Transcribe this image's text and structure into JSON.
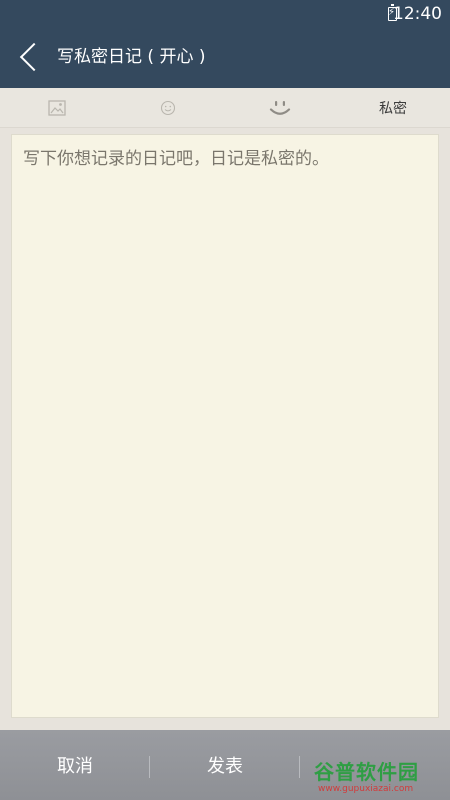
{
  "status_bar": {
    "time": "12:40"
  },
  "app_bar": {
    "title": "写私密日记 ( 开心 )"
  },
  "toolbar": {
    "private_label": "私密"
  },
  "editor": {
    "placeholder": "写下你想记录的日记吧，日记是私密的。"
  },
  "bottom_bar": {
    "cancel_label": "取消",
    "publish_label": "发表"
  },
  "watermark": {
    "brand": "谷普软件园",
    "url": "www.gupuxiazai.com"
  },
  "colors": {
    "header": "#34495e",
    "editor_background": "#f7f4e4",
    "bottom_bar": "#9a9ca1",
    "watermark_green": "#2f9e44",
    "watermark_red": "#d23b3b"
  }
}
